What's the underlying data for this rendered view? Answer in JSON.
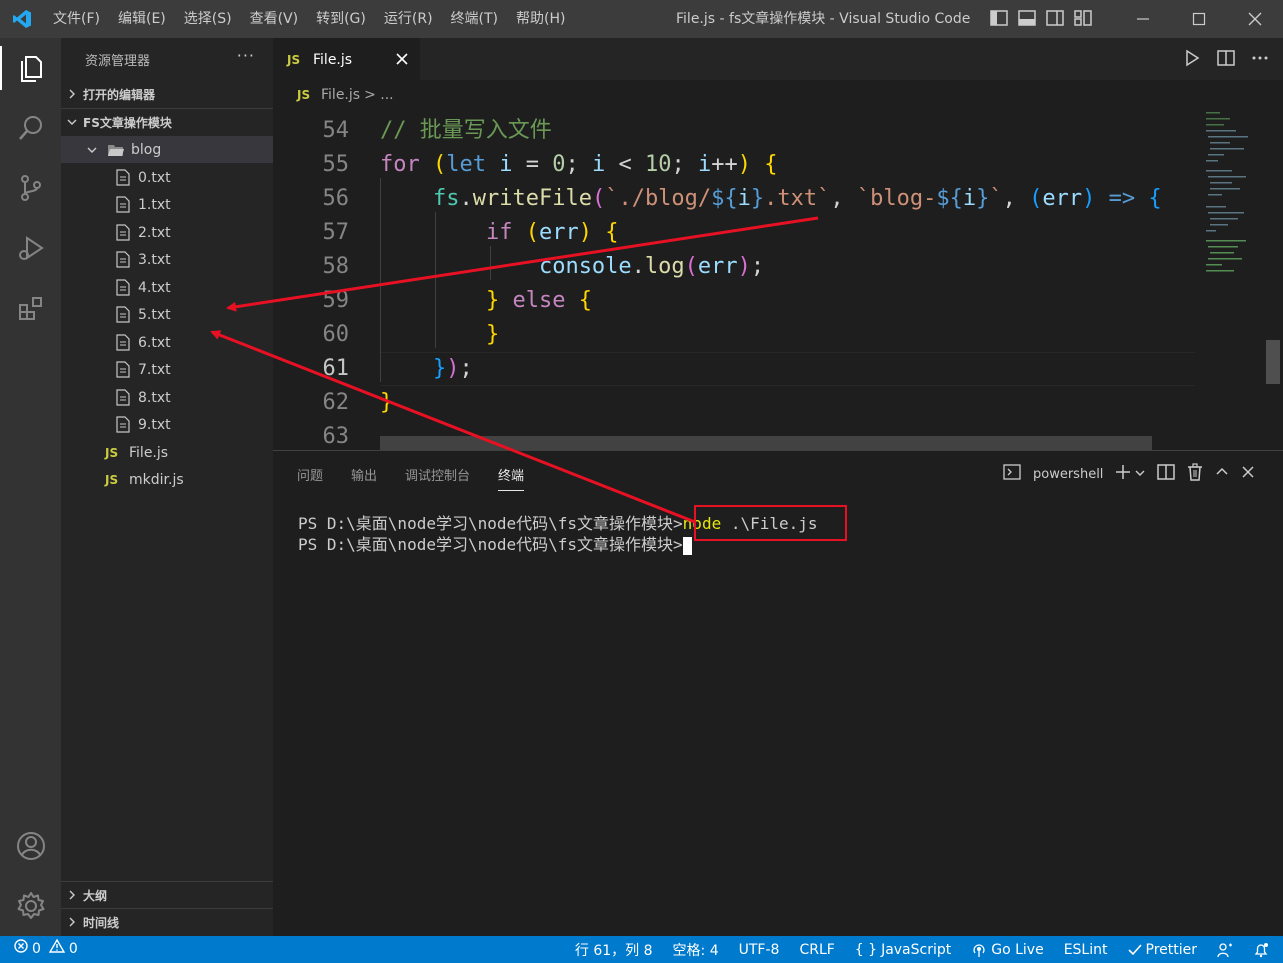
{
  "window": {
    "title": "File.js - fs文章操作模块 - Visual Studio Code",
    "menu": [
      "文件(F)",
      "编辑(E)",
      "选择(S)",
      "查看(V)",
      "转到(G)",
      "运行(R)",
      "终端(T)",
      "帮助(H)"
    ]
  },
  "sidebar": {
    "title": "资源管理器",
    "more": "···",
    "open_editors": "打开的编辑器",
    "project": "FS文章操作模块",
    "folder": "blog",
    "files": [
      "0.txt",
      "1.txt",
      "2.txt",
      "3.txt",
      "4.txt",
      "5.txt",
      "6.txt",
      "7.txt",
      "8.txt",
      "9.txt"
    ],
    "root_files": [
      "File.js",
      "mkdir.js"
    ],
    "outline": "大纲",
    "timeline": "时间线",
    "js_badge": "JS"
  },
  "editor": {
    "tab_label": "File.js",
    "breadcrumb_file": "File.js",
    "breadcrumb_rest": "> ...",
    "line_numbers": [
      "54",
      "55",
      "56",
      "57",
      "58",
      "59",
      "60",
      "61",
      "62",
      "63"
    ]
  },
  "panel": {
    "tabs": [
      "问题",
      "输出",
      "调试控制台",
      "终端"
    ],
    "shell": "powershell",
    "prompt": "PS D:\\桌面\\node学习\\node代码\\fs文章操作模块>",
    "command_node": "node",
    "command_args": " .\\File.js"
  },
  "statusbar": {
    "errors": "0",
    "warnings": "0",
    "position": "行 61，列 8",
    "spaces": "空格: 4",
    "encoding": "UTF-8",
    "eol": "CRLF",
    "language": "JavaScript",
    "golive": "Go Live",
    "eslint": "ESLint",
    "prettier": "Prettier"
  },
  "colors": {
    "accent": "#007acc",
    "annotation": "#e81123"
  }
}
